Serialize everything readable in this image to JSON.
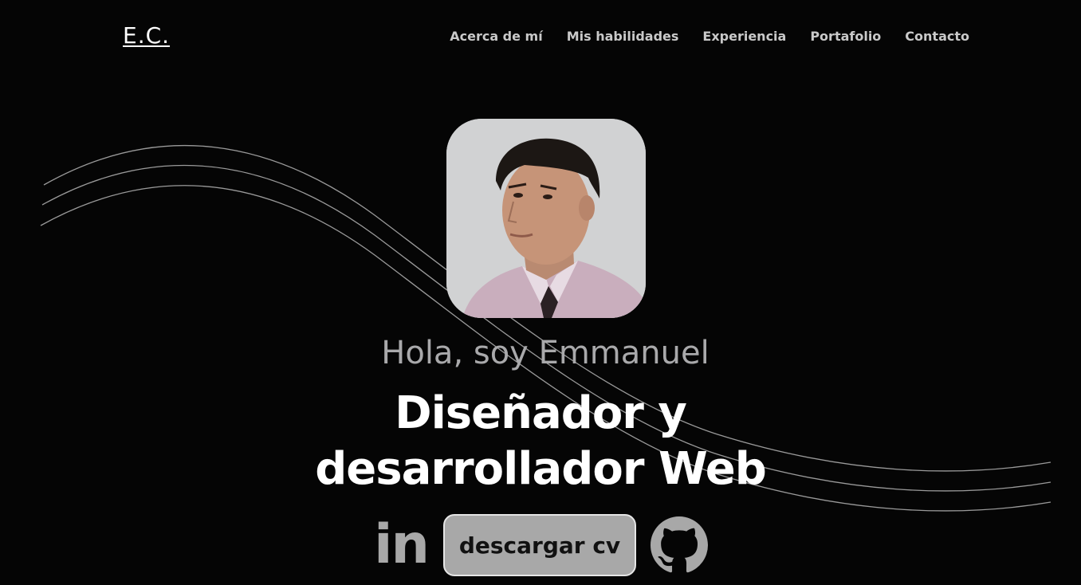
{
  "header": {
    "logo": "E.C.",
    "nav": [
      {
        "label": "Acerca de mí"
      },
      {
        "label": "Mis habilidades"
      },
      {
        "label": "Experiencia"
      },
      {
        "label": "Portafolio"
      },
      {
        "label": "Contacto"
      }
    ]
  },
  "hero": {
    "greeting": "Hola, soy Emmanuel",
    "role_line1": "Diseñador y",
    "role_line2": "desarrollador Web",
    "linkedin_label": "in",
    "cv_button": "descargar cv"
  },
  "colors": {
    "background": "#050505",
    "nav_text": "#c9c9c9",
    "greeting_text": "#a9a9ab",
    "heading_text": "#ffffff",
    "button_bg": "#a8a8a8",
    "icon_color": "#a8a8a8",
    "wave_lines": "#9a9a9a"
  },
  "icons": {
    "linkedin": "linkedin-icon",
    "github": "github-icon"
  }
}
